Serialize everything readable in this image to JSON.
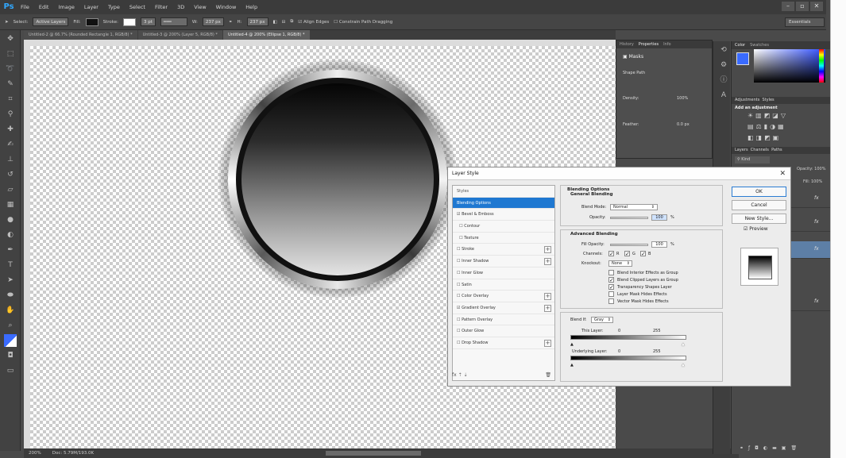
{
  "app": {
    "logo": "Ps"
  },
  "menu": [
    "File",
    "Edit",
    "Image",
    "Layer",
    "Type",
    "Select",
    "Filter",
    "3D",
    "View",
    "Window",
    "Help"
  ],
  "window_controls": {
    "minimize": "–",
    "maximize": "▫",
    "close": "✕"
  },
  "options_bar": {
    "select_label": "Select:",
    "select_value": "Active Layers",
    "fill_label": "Fill:",
    "stroke_label": "Stroke:",
    "stroke_width": "3 pt",
    "w_label": "W:",
    "w_value": "237 px",
    "h_label": "H:",
    "h_value": "237 px",
    "align_edges": "Align Edges",
    "constrain": "Constrain Path Dragging",
    "workspace": "Essentials"
  },
  "doc_tabs": [
    "Untitled-2 @ 66.7% (Rounded Rectangle 1, RGB/8) *",
    "Untitled-3 @ 200% (Layer 5, RGB/8) *",
    "Untitled-4 @ 200% (Ellipse 1, RGB/8) *"
  ],
  "status": {
    "zoom": "200%",
    "doc": "Doc: 5.79M/193.0K"
  },
  "properties_panel": {
    "tabs": [
      "History",
      "Properties",
      "Info"
    ],
    "masks_label": "Masks",
    "shape_path": "Shape Path",
    "density_label": "Density:",
    "density_value": "100%",
    "feather_label": "Feather:",
    "feather_value": "0.0 px"
  },
  "color_panel": {
    "tabs": [
      "Color",
      "Swatches"
    ]
  },
  "adjustments_panel": {
    "tabs": [
      "Adjustments",
      "Styles"
    ],
    "add_label": "Add an adjustment"
  },
  "layers_panel": {
    "tabs": [
      "Layers",
      "Channels",
      "Paths"
    ],
    "kind": "Kind",
    "opacity_label": "Opacity:",
    "opacity_value": "100%",
    "fill_label": "Fill:",
    "fill_value": "100%"
  },
  "dialog": {
    "title": "Layer Style",
    "styles": [
      {
        "label": "Styles",
        "checked": null,
        "plus": false
      },
      {
        "label": "Blending Options",
        "checked": null,
        "plus": false
      },
      {
        "label": "Bevel & Emboss",
        "checked": true,
        "plus": false
      },
      {
        "label": "Contour",
        "checked": false,
        "plus": false
      },
      {
        "label": "Texture",
        "checked": false,
        "plus": false
      },
      {
        "label": "Stroke",
        "checked": false,
        "plus": true
      },
      {
        "label": "Inner Shadow",
        "checked": false,
        "plus": true
      },
      {
        "label": "Inner Glow",
        "checked": false,
        "plus": false
      },
      {
        "label": "Satin",
        "checked": false,
        "plus": false
      },
      {
        "label": "Color Overlay",
        "checked": false,
        "plus": true
      },
      {
        "label": "Gradient Overlay",
        "checked": true,
        "plus": true
      },
      {
        "label": "Pattern Overlay",
        "checked": false,
        "plus": false
      },
      {
        "label": "Outer Glow",
        "checked": false,
        "plus": false
      },
      {
        "label": "Drop Shadow",
        "checked": false,
        "plus": true
      }
    ],
    "footer_icons": "fx  ⇡  ⇣",
    "trash": "🗑",
    "blending": {
      "group_title": "Blending Options",
      "general": "General Blending",
      "blend_mode_label": "Blend Mode:",
      "blend_mode": "Normal",
      "opacity_label": "Opacity:",
      "opacity_value": "100",
      "advanced": "Advanced Blending",
      "fill_opacity_label": "Fill Opacity:",
      "fill_opacity_value": "100",
      "percent": "%",
      "channels_label": "Channels:",
      "channel_r": "R",
      "channel_g": "G",
      "channel_b": "B",
      "knockout_label": "Knockout:",
      "knockout_value": "None",
      "options": [
        {
          "label": "Blend Interior Effects as Group",
          "checked": false
        },
        {
          "label": "Blend Clipped Layers as Group",
          "checked": true
        },
        {
          "label": "Transparency Shapes Layer",
          "checked": true
        },
        {
          "label": "Layer Mask Hides Effects",
          "checked": false
        },
        {
          "label": "Vector Mask Hides Effects",
          "checked": false
        }
      ],
      "blend_if_label": "Blend If:",
      "blend_if_value": "Gray",
      "this_layer_label": "This Layer:",
      "this_layer_min": "0",
      "this_layer_max": "255",
      "under_layer_label": "Underlying Layer:",
      "under_layer_min": "0",
      "under_layer_max": "255"
    },
    "buttons": {
      "ok": "OK",
      "cancel": "Cancel",
      "new_style": "New Style...",
      "preview": "Preview"
    }
  }
}
